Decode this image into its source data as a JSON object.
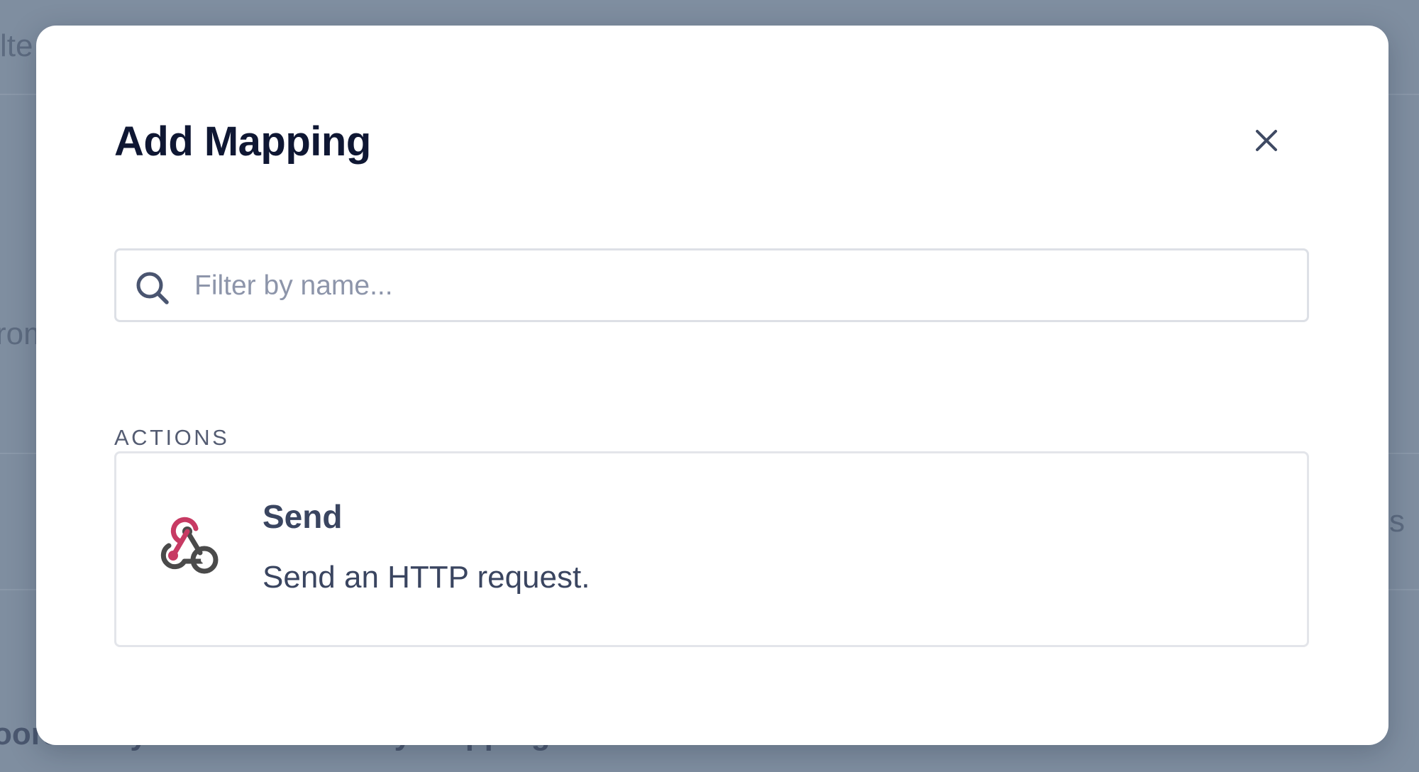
{
  "background": {
    "fragment_1": "lte",
    "fragment_2": "rom",
    "fragment_3": "s",
    "fragment_4": "oors like you don't have any mappings."
  },
  "modal": {
    "title": "Add Mapping",
    "close_icon": "close-icon",
    "search": {
      "placeholder": "Filter by name...",
      "value": "",
      "icon": "search-icon"
    },
    "section_label": "ACTIONS",
    "actions": [
      {
        "name": "Send",
        "description": "Send an HTTP request.",
        "icon": "webhook-icon"
      }
    ]
  },
  "colors": {
    "overlay": "#7f8ea0",
    "title": "#0f1733",
    "text": "#3a4560",
    "placeholder": "#8d95aa",
    "border": "#dde0e6",
    "webhook_accent": "#c73a63",
    "webhook_dark": "#4a4a4a"
  }
}
